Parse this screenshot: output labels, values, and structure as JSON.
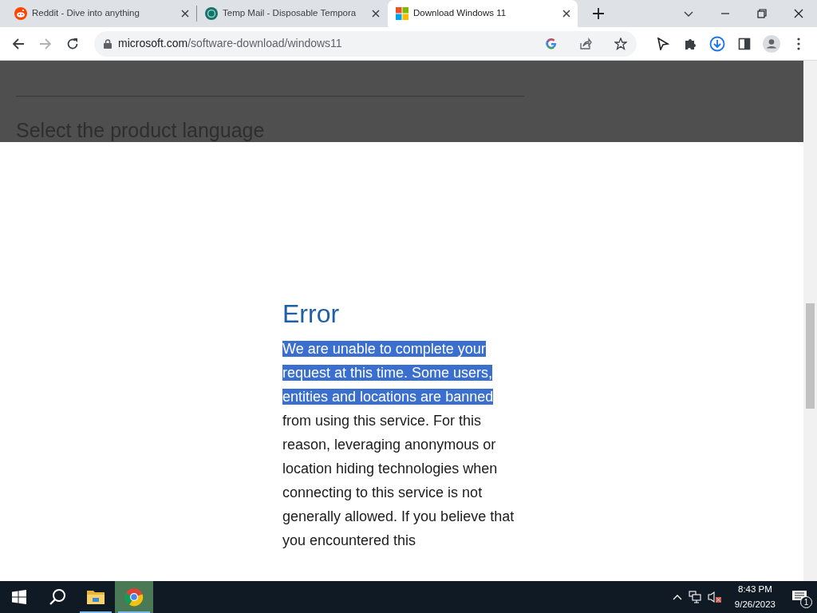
{
  "tabs": [
    {
      "title": "Reddit - Dive into anything",
      "kind": "reddit",
      "selected": false
    },
    {
      "title": "Temp Mail - Disposable Tempora",
      "kind": "tempmail",
      "selected": false
    },
    {
      "title": "Download Windows 11",
      "kind": "windows",
      "selected": true
    }
  ],
  "address": {
    "domain": "microsoft.com",
    "path": "/software-download/windows11"
  },
  "page": {
    "dimmed_heading": "Select the product language",
    "error_title": "Error",
    "error_paragraph": {
      "highlighted": "We are unable to complete your request at this time. Some users, entities and locations are banned",
      "rest": "from using this service. For this reason, leveraging anonymous or location hiding technologies when connecting to this service is not generally allowed. If you believe that you encountered this"
    }
  },
  "taskbar": {
    "apps": [
      {
        "kind": "start",
        "selected": false,
        "running": false
      },
      {
        "kind": "search",
        "selected": false,
        "running": false
      },
      {
        "kind": "explorer",
        "selected": false,
        "running": true
      },
      {
        "kind": "chrome",
        "selected": true,
        "running": true
      }
    ],
    "time": "8:43 PM",
    "date": "9/26/2023",
    "notification_count": "1"
  }
}
